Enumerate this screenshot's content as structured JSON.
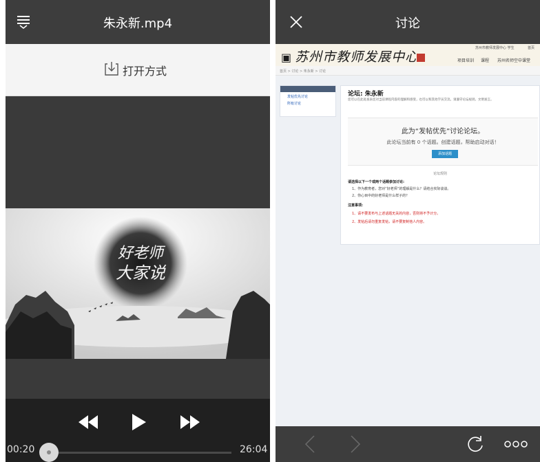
{
  "video_player": {
    "title": "朱永新.mp4",
    "open_with_label": "打开方式",
    "frame_calligraphy": "好老师 大家说",
    "current_time": "00:20",
    "total_time": "26:04",
    "progress_fraction": 0.0128
  },
  "discussion": {
    "title": "讨论",
    "site": {
      "logo_text": "苏州市教师发展中心",
      "top_links": [
        "苏州市教师发展中心 学生",
        "首页"
      ],
      "nav": [
        "项目培训",
        "课程",
        "苏州名师空中课堂"
      ],
      "breadcrumb": "首页 > 讨论 > 朱永新 > 讨论"
    },
    "sidebar": {
      "items": [
        "发帖优先讨论",
        "所有讨论"
      ]
    },
    "forum": {
      "title": "论坛: 朱永新",
      "description": "您可以在此处发表您对当前课程内容的理解和感受，也可以和其他学员交流。请遵守论坛规则，文明发言。",
      "heading": "此为“发帖优先”讨论论坛。",
      "subheading": "此论坛当前有 0 个话题。创建话题，帮助启动对话！",
      "add_button": "添加话题",
      "rules_header": "论坛规则",
      "rule_lines": [
        "请选择以下一个或两个话题参加讨论:",
        "1、作为教育者，您对“好老师”的理解是什么？请结合实际谈谈。",
        "2、你心目中的好老师是什么样子的？"
      ],
      "notes_header": "注意事项:",
      "notes": [
        "1、请不要发布与上述话题无关的内容，否则将不予计分。",
        "2、发帖后请勿重复发帖，请不要复制他人内容。"
      ]
    }
  },
  "colors": {
    "header_bg": "#3d3d3d",
    "controls_bg": "#202020",
    "forum_button": "#2d8fc9",
    "note_red": "#d02020"
  },
  "icons": {
    "menu": "hamburger-menu-icon",
    "open_with": "download-tray-icon",
    "rewind": "rewind-icon",
    "play": "play-icon",
    "fast_forward": "fast-forward-icon",
    "close": "close-icon",
    "back": "chevron-left-icon",
    "forward": "chevron-right-icon",
    "refresh": "refresh-icon",
    "more": "more-icon"
  }
}
